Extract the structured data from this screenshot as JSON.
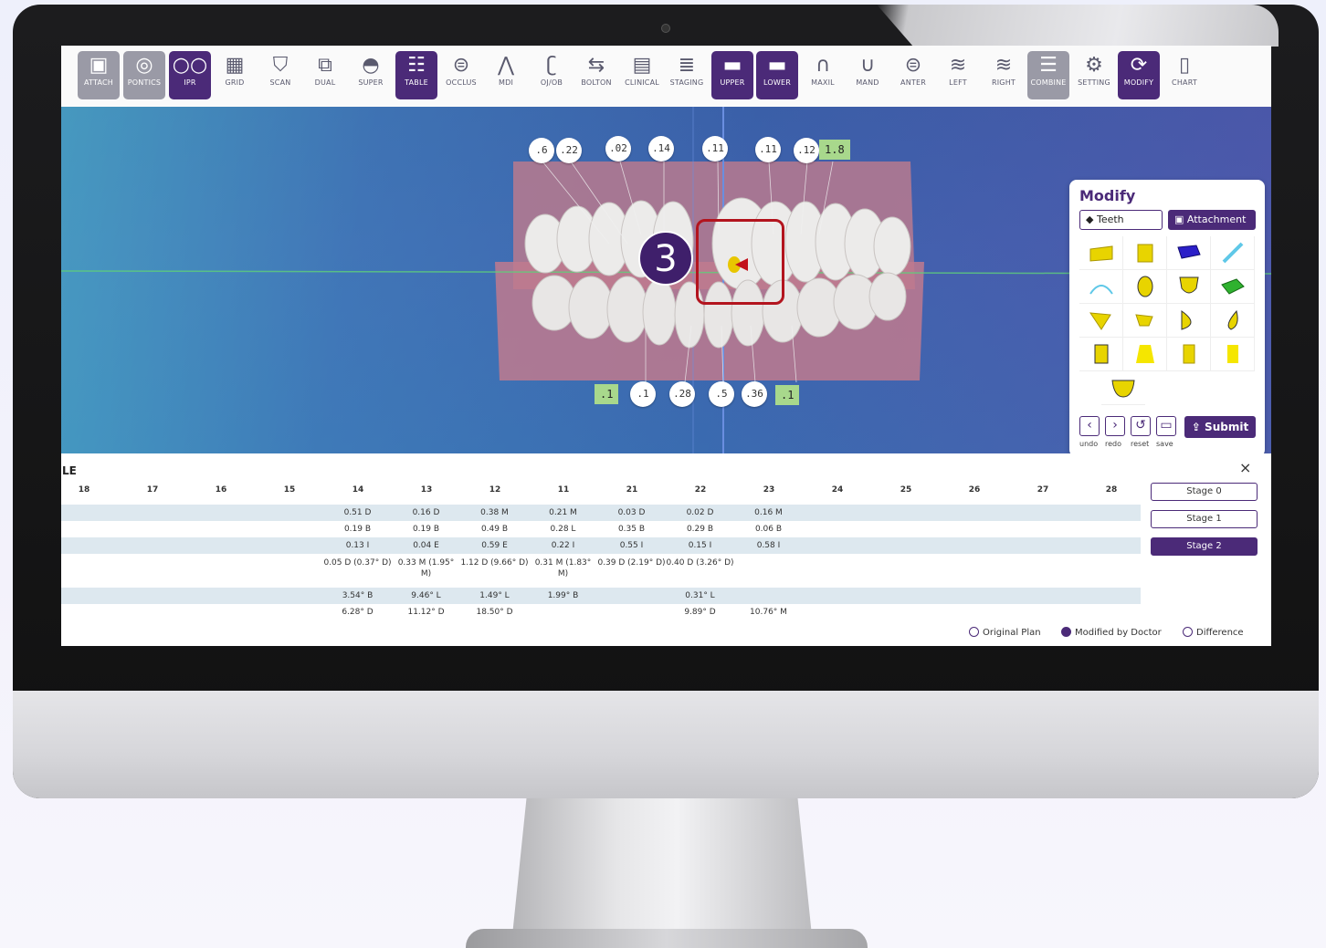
{
  "toolbar": {
    "items": [
      {
        "label": "ATTACH",
        "icon": "attach-icon",
        "state": "disabled"
      },
      {
        "label": "PONTICS",
        "icon": "pontics-icon",
        "state": "disabled"
      },
      {
        "label": "IPR",
        "icon": "ipr-icon",
        "state": "active"
      },
      {
        "label": "GRID",
        "icon": "grid-icon",
        "state": "normal"
      },
      {
        "label": "SCAN",
        "icon": "scan-icon",
        "state": "normal"
      },
      {
        "label": "DUAL",
        "icon": "dual-icon",
        "state": "normal"
      },
      {
        "label": "SUPER",
        "icon": "super-icon",
        "state": "normal"
      },
      {
        "label": "TABLE",
        "icon": "table-icon",
        "state": "active"
      },
      {
        "label": "OCCLUS",
        "icon": "occlus-icon",
        "state": "normal"
      },
      {
        "label": "MDI",
        "icon": "mdi-icon",
        "state": "normal"
      },
      {
        "label": "OJ/OB",
        "icon": "ojob-icon",
        "state": "normal"
      },
      {
        "label": "BOLTON",
        "icon": "bolton-icon",
        "state": "normal"
      },
      {
        "label": "CLINICAL",
        "icon": "clinical-icon",
        "state": "normal"
      },
      {
        "label": "STAGING",
        "icon": "staging-icon",
        "state": "normal"
      },
      {
        "label": "UPPER",
        "icon": "upper-icon",
        "state": "active"
      },
      {
        "label": "LOWER",
        "icon": "lower-icon",
        "state": "active"
      },
      {
        "label": "MAXIL",
        "icon": "maxil-icon",
        "state": "normal"
      },
      {
        "label": "MAND",
        "icon": "mand-icon",
        "state": "normal"
      },
      {
        "label": "ANTER",
        "icon": "anter-icon",
        "state": "normal"
      },
      {
        "label": "LEFT",
        "icon": "left-view-icon",
        "state": "normal"
      },
      {
        "label": "RIGHT",
        "icon": "right-view-icon",
        "state": "normal"
      },
      {
        "label": "COMBINE",
        "icon": "combine-icon",
        "state": "disabled"
      },
      {
        "label": "SETTING",
        "icon": "gear-icon",
        "state": "normal"
      },
      {
        "label": "MODIFY",
        "icon": "refresh-icon",
        "state": "active"
      },
      {
        "label": "CHART",
        "icon": "chart-icon",
        "state": "normal"
      }
    ]
  },
  "viewport": {
    "top_ipr": [
      ".6",
      ".22",
      ".02",
      ".14",
      ".11",
      ".11",
      ".12"
    ],
    "top_green": "1.8",
    "bottom_green_left": ".1",
    "bottom_ipr": [
      ".1",
      ".28",
      ".5",
      ".36"
    ],
    "bottom_green_right": ".1",
    "step_number": "3"
  },
  "modify": {
    "title": "Modify",
    "tab_teeth": "Teeth",
    "tab_attachment": "Attachment",
    "controls": [
      "undo",
      "redo",
      "reset",
      "save"
    ],
    "submit": "Submit"
  },
  "table": {
    "title": "LE",
    "close": "×",
    "headers": [
      "18",
      "17",
      "16",
      "15",
      "14",
      "13",
      "12",
      "11",
      "21",
      "22",
      "23",
      "24",
      "25",
      "26",
      "27",
      "28"
    ],
    "rows": [
      [
        "",
        "",
        "",
        "",
        "0.51 D",
        "0.16 D",
        "0.38 M",
        "0.21 M",
        "0.03 D",
        "0.02 D",
        "0.16 M",
        "",
        "",
        "",
        "",
        ""
      ],
      [
        "",
        "",
        "",
        "",
        "0.19 B",
        "0.19 B",
        "0.49 B",
        "0.28 L",
        "0.35 B",
        "0.29 B",
        "0.06 B",
        "",
        "",
        "",
        "",
        ""
      ],
      [
        "",
        "",
        "",
        "",
        "0.13 I",
        "0.04 E",
        "0.59 E",
        "0.22 I",
        "0.55 I",
        "0.15 I",
        "0.58 I",
        "",
        "",
        "",
        "",
        ""
      ],
      [
        "",
        "",
        "",
        "",
        "0.05 D (0.37° D)",
        "0.33 M (1.95° M)",
        "1.12 D (9.66° D)",
        "0.31 M (1.83° M)",
        "0.39 D (2.19° D)",
        "0.40 D (3.26° D)",
        "",
        "",
        "",
        "",
        "",
        ""
      ],
      [
        "",
        "",
        "",
        "",
        "3.54° B",
        "9.46° L",
        "1.49° L",
        "1.99° B",
        "",
        "0.31° L",
        "",
        "",
        "",
        "",
        "",
        ""
      ],
      [
        "",
        "",
        "",
        "",
        "6.28° D",
        "11.12° D",
        "18.50° D",
        "",
        "",
        "9.89° D",
        "10.76° M",
        "",
        "",
        "",
        "",
        ""
      ]
    ],
    "stages": [
      "Stage 0",
      "Stage 1",
      "Stage 2"
    ],
    "selected_stage": "Stage 2",
    "legend": [
      "Original Plan",
      "Modified by Doctor",
      "Difference"
    ],
    "legend_selected": "Modified by Doctor"
  },
  "colors": {
    "accent": "#4b2a78",
    "highlight": "#b3141e",
    "ipr_green": "#a8d88c"
  }
}
